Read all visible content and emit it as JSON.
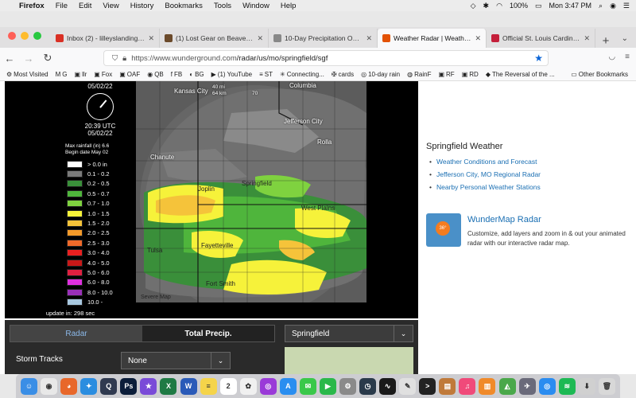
{
  "menubar": {
    "app": "Firefox",
    "items": [
      "File",
      "Edit",
      "View",
      "History",
      "Bookmarks",
      "Tools",
      "Window",
      "Help"
    ],
    "battery": "100%",
    "clock": "Mon 3:47 PM"
  },
  "tabs": [
    {
      "title": "Inbox (2) - lilleyslandingresort",
      "color": "#d93025"
    },
    {
      "title": "(1) Lost Gear on Beaver Creek",
      "color": "#6b4a2b"
    },
    {
      "title": "10-Day Precipitation Outlook for the",
      "color": "#888888"
    },
    {
      "title": "Weather Radar | Weather Underground",
      "color": "#e35205",
      "active": true
    },
    {
      "title": "Official St. Louis Cardinals Website",
      "color": "#c41e3a"
    }
  ],
  "url": {
    "host": "https://www.wunderground.com",
    "path": "/radar/us/mo/springfield/sgf"
  },
  "bookmarks": [
    {
      "icon": "⚙",
      "label": "Most Visited"
    },
    {
      "icon": "M",
      "label": "G"
    },
    {
      "icon": "▣",
      "label": "llr"
    },
    {
      "icon": "▣",
      "label": "Fox"
    },
    {
      "icon": "▣",
      "label": "OAF"
    },
    {
      "icon": "◉",
      "label": "QB"
    },
    {
      "icon": "f",
      "label": "FB"
    },
    {
      "icon": "◐",
      "label": "BG"
    },
    {
      "icon": "▶",
      "label": "(1) YouTube"
    },
    {
      "icon": "≡",
      "label": "ST"
    },
    {
      "icon": "✳",
      "label": "Connecting..."
    },
    {
      "icon": "✠",
      "label": "cards"
    },
    {
      "icon": "◎",
      "label": "10-day rain"
    },
    {
      "icon": "◍",
      "label": "RainF"
    },
    {
      "icon": "▣",
      "label": "RF"
    },
    {
      "icon": "▣",
      "label": "RD"
    },
    {
      "icon": "◆",
      "label": "The Reversal of the ..."
    }
  ],
  "other_bookmarks": "Other Bookmarks",
  "radar": {
    "date_top": "05/02/22",
    "time_utc": "20:39 UTC",
    "date_bottom": "05/02/22",
    "max_label": "Max rainfall (in) 6.6",
    "begin_label": "Begin date May 02",
    "legend": [
      {
        "label": "> 0.0 in",
        "color": "#ffffff"
      },
      {
        "label": "0.1 - 0.2",
        "color": "#7a7a7a"
      },
      {
        "label": "0.2 - 0.5",
        "color": "#3a8f3a"
      },
      {
        "label": "0.5 - 0.7",
        "color": "#4fb53c"
      },
      {
        "label": "0.7 - 1.0",
        "color": "#7fd23f"
      },
      {
        "label": "1.0 - 1.5",
        "color": "#f6f23a"
      },
      {
        "label": "1.5 - 2.0",
        "color": "#f5c33a"
      },
      {
        "label": "2.0 - 2.5",
        "color": "#f39a2a"
      },
      {
        "label": "2.5 - 3.0",
        "color": "#f06a2a"
      },
      {
        "label": "3.0 - 4.0",
        "color": "#e82020"
      },
      {
        "label": "4.0 - 5.0",
        "color": "#c81818"
      },
      {
        "label": "5.0 - 6.0",
        "color": "#e02040"
      },
      {
        "label": "6.0 - 8.0",
        "color": "#e030e0"
      },
      {
        "label": "8.0 - 10.0",
        "color": "#9a30b8"
      },
      {
        "label": "10.0 -",
        "color": "#a8c8e0"
      }
    ],
    "update": "update in: 298 sec",
    "cities": [
      "Columbia",
      "Jefferson City",
      "Rolla",
      "Chanute",
      "Joplin",
      "Springfield",
      "West Plains",
      "Fayetteville",
      "Tulsa",
      "Fort Smith",
      "Kansas City",
      "Severe Map"
    ],
    "scale_top": "40 mi",
    "scale_bottom": "64 km",
    "road": "70"
  },
  "controls": {
    "tab_radar": "Radar",
    "tab_total": "Total Precip.",
    "storm_label": "Storm Tracks",
    "storm_value": "None",
    "location": "Springfield"
  },
  "sidebar": {
    "title": "Springfield Weather",
    "links": [
      "Weather Conditions and Forecast",
      "Jefferson City, MO Regional Radar",
      "Nearby Personal Weather Stations"
    ],
    "wm_title": "WunderMap Radar",
    "wm_desc": "Customize, add layers and zoom in & out your animated radar with our interactive radar map.",
    "wm_badge": "36°"
  },
  "dock": [
    {
      "name": "finder",
      "color": "#3a8ee6",
      "glyph": "☺"
    },
    {
      "name": "chrome",
      "color": "#e8e8e8",
      "glyph": "◉"
    },
    {
      "name": "firefox",
      "color": "#e8672a",
      "glyph": "◕"
    },
    {
      "name": "safari",
      "color": "#2b8de0",
      "glyph": "✦"
    },
    {
      "name": "quicktime",
      "color": "#303a50",
      "glyph": "Q"
    },
    {
      "name": "photoshop",
      "color": "#0b1d3a",
      "glyph": "Ps"
    },
    {
      "name": "imovie",
      "color": "#7a4ad8",
      "glyph": "★"
    },
    {
      "name": "excel",
      "color": "#1f7a44",
      "glyph": "X"
    },
    {
      "name": "word",
      "color": "#2a5ab8",
      "glyph": "W"
    },
    {
      "name": "notes",
      "color": "#f5d44a",
      "glyph": "≡"
    },
    {
      "name": "calendar",
      "color": "#ffffff",
      "glyph": "2"
    },
    {
      "name": "photos",
      "color": "#f0f0f0",
      "glyph": "✿"
    },
    {
      "name": "podcasts",
      "color": "#9a3ad8",
      "glyph": "◎"
    },
    {
      "name": "appstore",
      "color": "#2a8ef0",
      "glyph": "A"
    },
    {
      "name": "messages",
      "color": "#3ac84a",
      "glyph": "✉"
    },
    {
      "name": "facetime",
      "color": "#2ab84a",
      "glyph": "▶"
    },
    {
      "name": "system",
      "color": "#8a8a8a",
      "glyph": "⚙"
    },
    {
      "name": "timemachine",
      "color": "#2a3a4a",
      "glyph": "◷"
    },
    {
      "name": "activity",
      "color": "#1a1a1a",
      "glyph": "∿"
    },
    {
      "name": "textedit",
      "color": "#e0e0e0",
      "glyph": "✎"
    },
    {
      "name": "terminal",
      "color": "#222222",
      "glyph": ">"
    },
    {
      "name": "preview",
      "color": "#c07a3a",
      "glyph": "▤"
    },
    {
      "name": "itunes",
      "color": "#f04a7a",
      "glyph": "♫"
    },
    {
      "name": "books",
      "color": "#f08a2a",
      "glyph": "▥"
    },
    {
      "name": "maps",
      "color": "#4aa84a",
      "glyph": "◭"
    },
    {
      "name": "launchpad",
      "color": "#6a6a7a",
      "glyph": "✈"
    },
    {
      "name": "zoom",
      "color": "#2a8cf0",
      "glyph": "◎"
    },
    {
      "name": "spotify",
      "color": "#1db954",
      "glyph": "≋"
    },
    {
      "name": "downloads",
      "color": "#d0d0d0",
      "glyph": "⬇"
    },
    {
      "name": "trash",
      "color": "#d8d8d8",
      "glyph": "🗑"
    }
  ]
}
